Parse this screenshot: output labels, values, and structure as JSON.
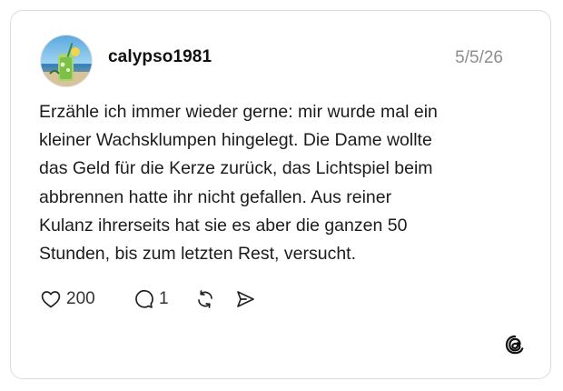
{
  "post": {
    "username": "calypso1981",
    "date": "5/5/26",
    "text_lines": [
      "Erzähle ich immer wieder gerne: mir wurde mal ein",
      "kleiner Wachsklumpen hingelegt. Die Dame wollte",
      "das Geld für die Kerze zurück, das Lichtspiel beim",
      "abbrennen hatte ihr nicht gefallen. Aus reiner",
      "Kulanz ihrerseits hat sie es aber die ganzen 50",
      "Stunden, bis zum letzten Rest, versucht."
    ]
  },
  "actions": {
    "like_count": "200",
    "reply_count": "1",
    "icons": [
      "heart-icon",
      "comment-icon",
      "repost-icon",
      "share-icon"
    ]
  },
  "branding": {
    "logo": "threads-logo-icon"
  },
  "colors": {
    "text": "#1c1c1c",
    "muted": "#8e8e8e",
    "border": "#dcdcdc"
  }
}
